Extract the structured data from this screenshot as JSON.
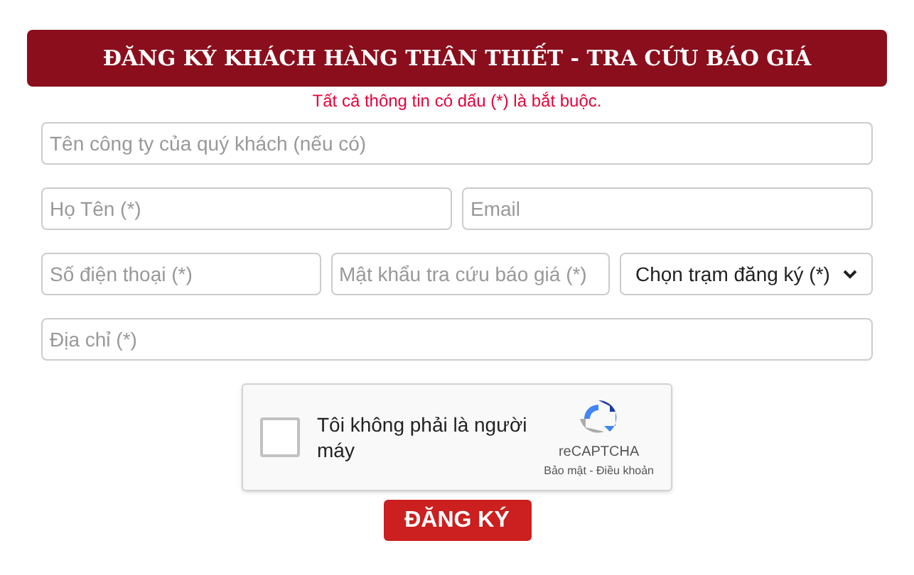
{
  "header": {
    "title": "ĐĂNG KÝ KHÁCH HÀNG THÂN THIẾT - TRA CỨU BÁO GIÁ"
  },
  "note": "Tất cả thông tin có dấu (*) là bắt buộc.",
  "rows": [
    [
      {
        "kind": "input",
        "placeholder": "Tên công ty của quý khách (nếu có)"
      }
    ],
    [
      {
        "kind": "input",
        "placeholder": "Họ Tên (*)"
      },
      {
        "kind": "input",
        "placeholder": "Email"
      }
    ],
    [
      {
        "kind": "input",
        "placeholder": "Số điện thoại (*)"
      },
      {
        "kind": "input",
        "placeholder": "Mật khẩu tra cứu báo giá (*)"
      },
      {
        "kind": "select",
        "value": "Chọn trạm đăng ký (*)"
      }
    ],
    [
      {
        "kind": "input",
        "placeholder": "Địa chỉ (*)"
      }
    ]
  ],
  "captcha": {
    "checked": false,
    "label": "Tôi không phải là người máy",
    "brand": "reCAPTCHA",
    "links": "Bảo mật - Điều khoản"
  },
  "submit": "ĐĂNG KÝ"
}
